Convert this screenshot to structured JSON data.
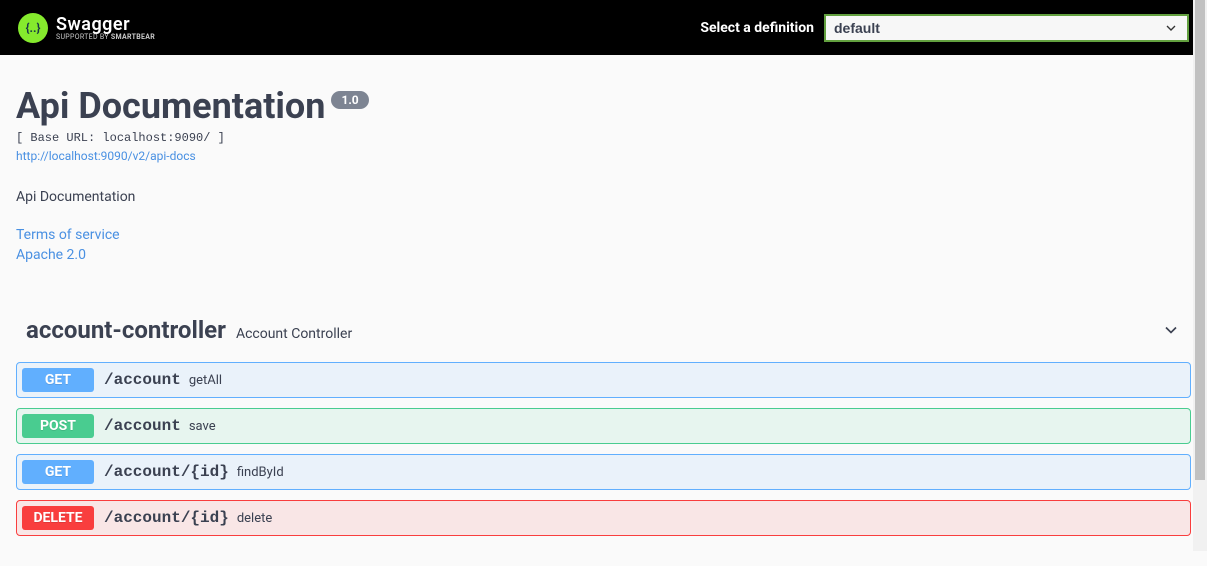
{
  "topbar": {
    "logo_glyph": "{..}",
    "logo_main": "Swagger",
    "logo_sub_prefix": "Supported by ",
    "logo_sub_brand": "SMARTBEAR",
    "def_label": "Select a definition",
    "def_selected": "default"
  },
  "info": {
    "title": "Api Documentation",
    "version": "1.0",
    "base_url": "[ Base URL: localhost:9090/ ]",
    "docs_url": "http://localhost:9090/v2/api-docs",
    "description": "Api Documentation",
    "tos": "Terms of service",
    "license": "Apache 2.0"
  },
  "tag": {
    "name": "account-controller",
    "description": "Account Controller"
  },
  "ops": [
    {
      "method": "GET",
      "method_class": "get",
      "path": "/account",
      "summary": "getAll"
    },
    {
      "method": "POST",
      "method_class": "post",
      "path": "/account",
      "summary": "save"
    },
    {
      "method": "GET",
      "method_class": "get",
      "path": "/account/{id}",
      "summary": "findById"
    },
    {
      "method": "DELETE",
      "method_class": "delete",
      "path": "/account/{id}",
      "summary": "delete"
    }
  ]
}
